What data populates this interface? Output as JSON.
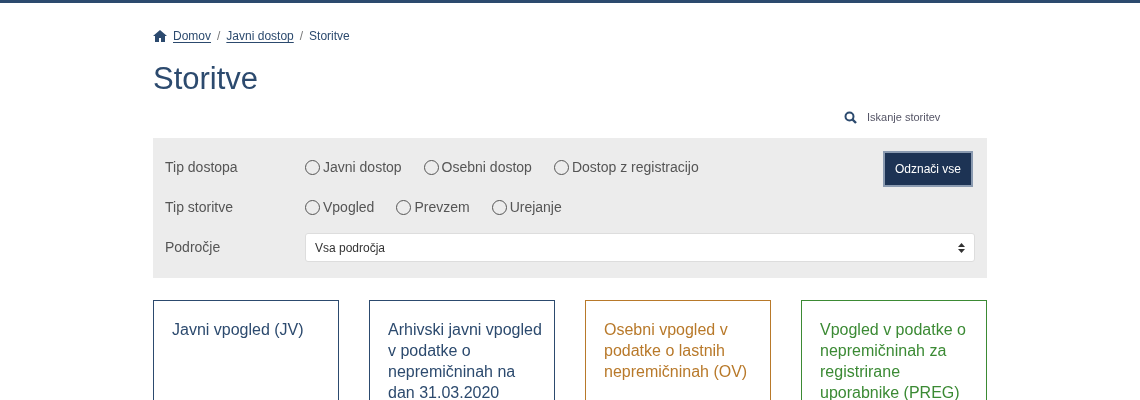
{
  "breadcrumbs": [
    {
      "label": "Domov",
      "link": true
    },
    {
      "separator": "/",
      "label": "Javni dostop",
      "link": true
    },
    {
      "separator": "/",
      "label": "Storitve",
      "link": false
    }
  ],
  "title": "Storitve",
  "search": {
    "placeholder": "Iskanje storitev"
  },
  "filters": {
    "rows": [
      {
        "label": "Tip dostopa",
        "kind": "radios",
        "options": [
          {
            "label": "Javni dostop",
            "selected": false
          },
          {
            "label": "Osebni dostop",
            "selected": false
          },
          {
            "label": "Dostop z registracijo",
            "selected": false
          }
        ]
      },
      {
        "label": "Tip storitve",
        "kind": "radios",
        "options": [
          {
            "label": "Vpogled",
            "selected": false
          },
          {
            "label": "Prevzem",
            "selected": false
          },
          {
            "label": "Urejanje",
            "selected": false
          }
        ]
      },
      {
        "label": "Področje",
        "kind": "select",
        "value": "Vsa področja"
      }
    ],
    "clear_button": "Odznači vse"
  },
  "cards": [
    {
      "title": "Javni vpogled (JV)",
      "color": "#2c4a6e"
    },
    {
      "title": "Arhivski javni vpogled v podatke o nepremičninah na dan 31.03.2020",
      "color": "#2c4a6e"
    },
    {
      "title": "Osebni vpogled v podatke o lastnih nepremičninah (OV)",
      "color": "#b8792a"
    },
    {
      "title": "Vpogled v podatke o nepremičninah za registrirane uporabnike (PREG)",
      "color": "#3b8a34"
    }
  ]
}
